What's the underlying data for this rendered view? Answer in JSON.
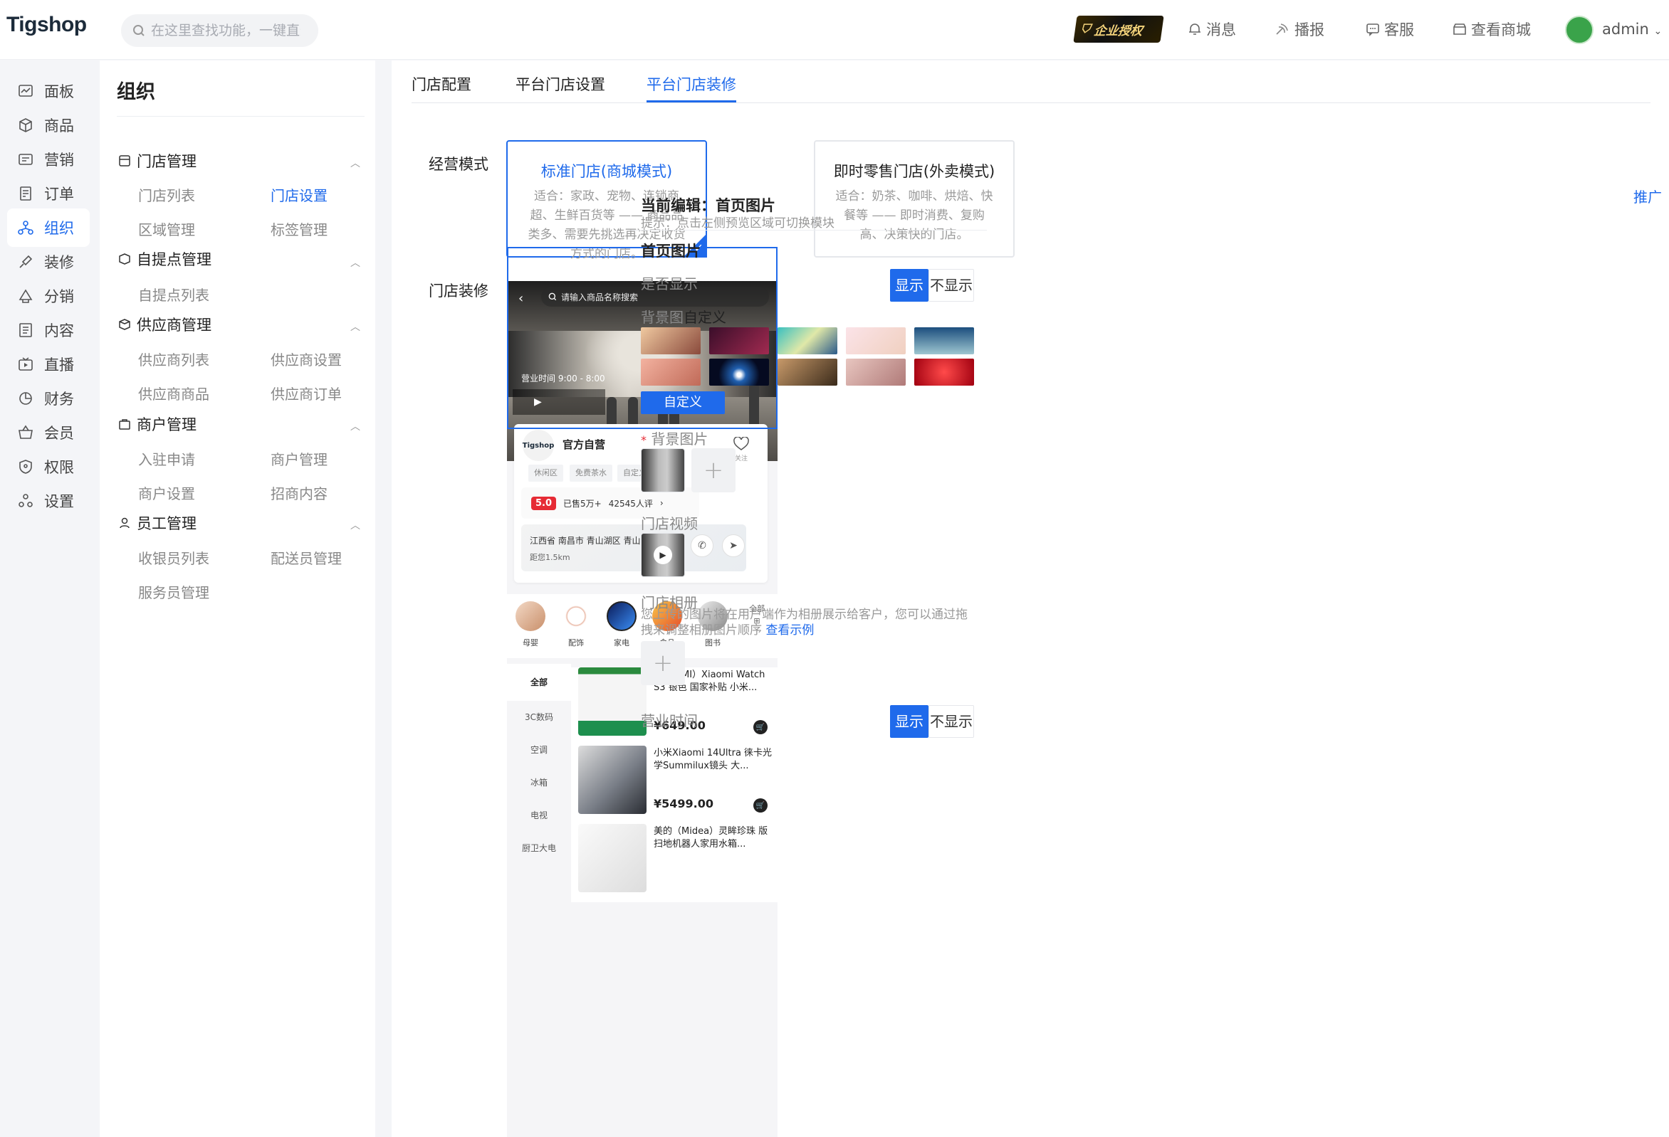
{
  "header": {
    "logo": "Tigshop",
    "search_placeholder": "在这里查找功能，一键直达",
    "auth_badge": "企业授权",
    "links": [
      {
        "label": "消息",
        "icon": "bell-icon"
      },
      {
        "label": "播报",
        "icon": "broadcast-icon"
      },
      {
        "label": "客服",
        "icon": "chat-icon"
      },
      {
        "label": "查看商城",
        "icon": "store-icon"
      }
    ],
    "user": "admin"
  },
  "leftnav": [
    {
      "label": "面板",
      "icon": "chart-icon"
    },
    {
      "label": "商品",
      "icon": "box-icon"
    },
    {
      "label": "营销",
      "icon": "tag-icon"
    },
    {
      "label": "订单",
      "icon": "order-icon"
    },
    {
      "label": "组织",
      "icon": "org-icon",
      "active": true
    },
    {
      "label": "装修",
      "icon": "brush-icon"
    },
    {
      "label": "分销",
      "icon": "share-icon"
    },
    {
      "label": "内容",
      "icon": "doc-icon"
    },
    {
      "label": "直播",
      "icon": "live-icon"
    },
    {
      "label": "财务",
      "icon": "pie-icon"
    },
    {
      "label": "会员",
      "icon": "basket-icon"
    },
    {
      "label": "权限",
      "icon": "shield-icon"
    },
    {
      "label": "设置",
      "icon": "settings-icon"
    }
  ],
  "submenu": {
    "title": "组织",
    "groups": [
      {
        "label": "门店管理",
        "icon": "store-manage-icon",
        "items": [
          "门店列表",
          "门店设置",
          "区域管理",
          "标签管理"
        ]
      },
      {
        "label": "自提点管理",
        "icon": "pickup-icon",
        "items": [
          "自提点列表"
        ]
      },
      {
        "label": "供应商管理",
        "icon": "supplier-icon",
        "items": [
          "供应商列表",
          "供应商设置",
          "供应商商品",
          "供应商订单"
        ]
      },
      {
        "label": "商户管理",
        "icon": "merchant-icon",
        "items": [
          "入驻申请",
          "商户管理",
          "商户设置",
          "招商内容"
        ]
      },
      {
        "label": "员工管理",
        "icon": "staff-icon",
        "items": [
          "收银员列表",
          "配送员管理",
          "服务员管理"
        ]
      }
    ],
    "active_item": "门店设置"
  },
  "tabs": [
    "门店配置",
    "平台门店设置",
    "平台门店装修"
  ],
  "active_tab": "平台门店装修",
  "form": {
    "mode_label": "经营模式",
    "modes": [
      {
        "title": "标准门店(商城模式)",
        "desc": "适合：家政、宠物、连锁商超、生鲜百货等 —— 商品品类多、需要先挑选再决定收货方式的门店。",
        "selected": true
      },
      {
        "title": "即时零售门店(外卖模式)",
        "desc": "适合：奶茶、咖啡、烘焙、快餐等 —— 即时消费、复购高、决策快的门店。",
        "selected": false
      }
    ],
    "decor_label": "门店装修"
  },
  "preview": {
    "search_placeholder": "请输入商品名称搜索",
    "hours": "营业时间 9:00 - 8:00",
    "store_logo": "Tigshop",
    "store_name": "官方自营",
    "fav_label": "关注",
    "tags": [
      "休闲区",
      "免费茶水",
      "自定义标签1"
    ],
    "rating": "5.0",
    "sold": "已售5万+",
    "reviews": "42545人评",
    "address": "江西省 南昌市 青山湖区 青山湖...",
    "distance": "距您1.5km",
    "categories": [
      "母婴",
      "配饰",
      "家电",
      "食品",
      "图书"
    ],
    "all_label": "全部",
    "side_categories": [
      "全部",
      "3C数码",
      "空调",
      "冰箱",
      "电视",
      "厨卫大电"
    ],
    "products": [
      {
        "name": "小米（MI）Xiaomi Watch S3 银色 国家补贴 小米...",
        "price": "¥649.00"
      },
      {
        "name": "小米Xiaomi 14Ultra 徕卡光学Summilux镜头 大...",
        "price": "¥5499.00"
      },
      {
        "name": "美的（Midea）灵眸珍珠 版扫地机器人家用水箱...",
        "price": ""
      }
    ]
  },
  "editor": {
    "promo": "推广",
    "title": "当前编辑：首页图片",
    "hint": "提示：点击左侧预览区域可切换模块",
    "section": "首页图片",
    "show_label": "是否显示",
    "show": "显示",
    "hide": "不显示",
    "bg_label": "背景图",
    "bg_custom": "自定义",
    "custom_button": "自定义",
    "bg_image_label": "背景图片",
    "required_mark": "*",
    "video_label": "门店视频",
    "album_label": "门店相册",
    "album_desc": "您上传的图片将在用户端作为相册展示给客户，您可以通过拖拽来调整相册图片顺序",
    "album_link": "查看示例",
    "hours_label": "营业时间",
    "hours_show": "显示",
    "hours_hide": "不显示"
  },
  "colors": {
    "accent": "#1f6aeb",
    "rating": "#e62b35"
  }
}
